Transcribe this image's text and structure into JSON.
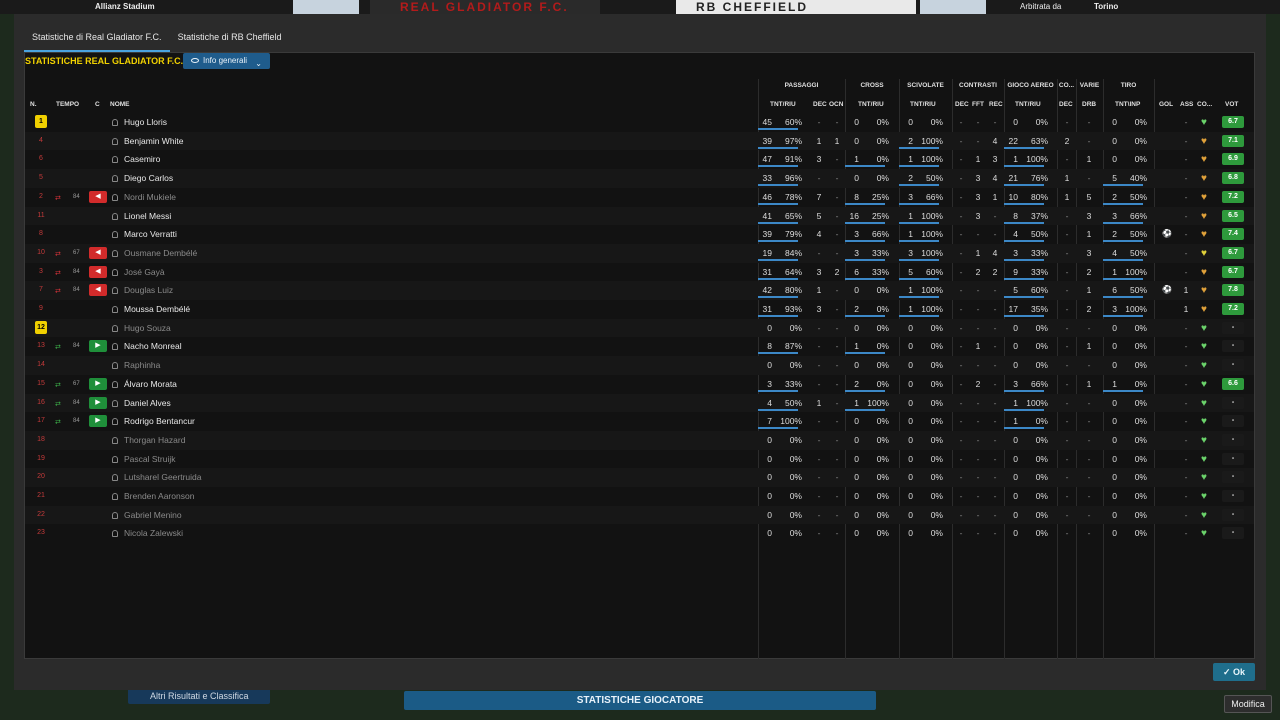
{
  "background": {
    "stadium": "Allianz Stadium",
    "referee": "Arbitrata da",
    "city": "Torino",
    "banner_left": "REAL GLADIATOR F.C.",
    "banner_right": "RB CHEFFIELD",
    "other_results": "Altri Risultati e Classifica",
    "player_stats": "STATISTICHE GIOCATORE",
    "edit": "Modifica"
  },
  "tabs": [
    "Statistiche di Real Gladiator F.C.",
    "Statistiche di RB Cheffield"
  ],
  "panel": {
    "title": "STATISTICHE REAL GLADIATOR F.C.",
    "view_button": "Info generali"
  },
  "ok_button": "Ok",
  "groups": [
    "PASSAGGI",
    "CROSS",
    "SCIVOLATE",
    "CONTRASTI",
    "GIOCO AEREO",
    "CO...",
    "VARIE",
    "TIRO"
  ],
  "headers": {
    "n": "N.",
    "tempo": "TEMPO",
    "c": "C",
    "nome": "NOME",
    "pass": "TNT/RIU",
    "dec": "DEC",
    "ocn": "OCN",
    "cross": "TNT/RIU",
    "scivolate": "TNT/RIU",
    "cdec": "DEC",
    "fft": "FFT",
    "rec": "REC",
    "aereo": "TNT/RIU",
    "codec": "DEC",
    "drb": "DRB",
    "tiro": "TNT\\INP",
    "gol": "GOL",
    "ass": "ASS",
    "co": "CO...",
    "vot": "VOT"
  },
  "players": [
    {
      "n": "1",
      "gk": true,
      "name": "Hugo Lloris",
      "dim": false,
      "sub": null,
      "p": [
        "45",
        "60%"
      ],
      "pd": "-",
      "po": "-",
      "c": [
        "0",
        "0%"
      ],
      "s": [
        "0",
        "0%"
      ],
      "cd": "-",
      "cf": "-",
      "cr": "-",
      "a": [
        "0",
        "0%"
      ],
      "ad": "-",
      "drb": "-",
      "t": [
        "0",
        "0%"
      ],
      "gol": "",
      "ass": "-",
      "vote": "6.7",
      "hc": "#6bd36b"
    },
    {
      "n": "4",
      "name": "Benjamin White",
      "dim": false,
      "sub": null,
      "p": [
        "39",
        "97%"
      ],
      "pd": "1",
      "po": "1",
      "c": [
        "0",
        "0%"
      ],
      "s": [
        "2",
        "100%"
      ],
      "cd": "-",
      "cf": "-",
      "cr": "4",
      "a": [
        "22",
        "63%"
      ],
      "ad": "2",
      "drb": "-",
      "t": [
        "0",
        "0%"
      ],
      "gol": "",
      "ass": "-",
      "vote": "7.1",
      "hc": "#e0a13a"
    },
    {
      "n": "6",
      "name": "Casemiro",
      "dim": false,
      "sub": null,
      "p": [
        "47",
        "91%"
      ],
      "pd": "3",
      "po": "-",
      "c": [
        "1",
        "0%"
      ],
      "s": [
        "1",
        "100%"
      ],
      "cd": "-",
      "cf": "1",
      "cr": "3",
      "a": [
        "1",
        "100%"
      ],
      "ad": "-",
      "drb": "1",
      "t": [
        "0",
        "0%"
      ],
      "gol": "",
      "ass": "-",
      "vote": "6.9",
      "hc": "#e0a13a"
    },
    {
      "n": "5",
      "name": "Diego Carlos",
      "dim": false,
      "sub": null,
      "p": [
        "33",
        "96%"
      ],
      "pd": "-",
      "po": "-",
      "c": [
        "0",
        "0%"
      ],
      "s": [
        "2",
        "50%"
      ],
      "cd": "-",
      "cf": "3",
      "cr": "4",
      "a": [
        "21",
        "76%"
      ],
      "ad": "1",
      "drb": "-",
      "t": [
        "5",
        "40%"
      ],
      "gol": "",
      "ass": "-",
      "vote": "6.8",
      "hc": "#e0a13a"
    },
    {
      "n": "2",
      "name": "Nordi Mukiele",
      "dim": true,
      "sub": {
        "type": "off",
        "min": "84"
      },
      "p": [
        "46",
        "78%"
      ],
      "pd": "7",
      "po": "-",
      "c": [
        "8",
        "25%"
      ],
      "s": [
        "3",
        "66%"
      ],
      "cd": "-",
      "cf": "3",
      "cr": "1",
      "a": [
        "10",
        "80%"
      ],
      "ad": "1",
      "drb": "5",
      "t": [
        "2",
        "50%"
      ],
      "gol": "",
      "ass": "-",
      "vote": "7.2",
      "hc": "#e0a13a"
    },
    {
      "n": "11",
      "name": "Lionel Messi",
      "dim": false,
      "sub": null,
      "p": [
        "41",
        "65%"
      ],
      "pd": "5",
      "po": "-",
      "c": [
        "16",
        "25%"
      ],
      "s": [
        "1",
        "100%"
      ],
      "cd": "-",
      "cf": "3",
      "cr": "-",
      "a": [
        "8",
        "37%"
      ],
      "ad": "-",
      "drb": "3",
      "t": [
        "3",
        "66%"
      ],
      "gol": "",
      "ass": "-",
      "vote": "6.5",
      "hc": "#e0a13a"
    },
    {
      "n": "8",
      "name": "Marco Verratti",
      "dim": false,
      "sub": null,
      "p": [
        "39",
        "79%"
      ],
      "pd": "4",
      "po": "-",
      "c": [
        "3",
        "66%"
      ],
      "s": [
        "1",
        "100%"
      ],
      "cd": "-",
      "cf": "-",
      "cr": "-",
      "a": [
        "4",
        "50%"
      ],
      "ad": "-",
      "drb": "1",
      "t": [
        "2",
        "50%"
      ],
      "gol": "ball",
      "ass": "-",
      "vote": "7.4",
      "hc": "#e0a13a"
    },
    {
      "n": "10",
      "name": "Ousmane Dembélé",
      "dim": true,
      "sub": {
        "type": "off",
        "min": "67"
      },
      "p": [
        "19",
        "84%"
      ],
      "pd": "-",
      "po": "-",
      "c": [
        "3",
        "33%"
      ],
      "s": [
        "3",
        "100%"
      ],
      "cd": "-",
      "cf": "1",
      "cr": "4",
      "a": [
        "3",
        "33%"
      ],
      "ad": "-",
      "drb": "3",
      "t": [
        "4",
        "50%"
      ],
      "gol": "",
      "ass": "-",
      "vote": "6.7",
      "hc": "#e0d03a"
    },
    {
      "n": "3",
      "name": "José Gayà",
      "dim": true,
      "sub": {
        "type": "off",
        "min": "84"
      },
      "p": [
        "31",
        "64%"
      ],
      "pd": "3",
      "po": "2",
      "c": [
        "6",
        "33%"
      ],
      "s": [
        "5",
        "60%"
      ],
      "cd": "-",
      "cf": "2",
      "cr": "2",
      "a": [
        "9",
        "33%"
      ],
      "ad": "-",
      "drb": "2",
      "t": [
        "1",
        "100%"
      ],
      "gol": "",
      "ass": "-",
      "vote": "6.7",
      "hc": "#e0a13a"
    },
    {
      "n": "7",
      "name": "Douglas Luiz",
      "dim": true,
      "sub": {
        "type": "off",
        "min": "84"
      },
      "p": [
        "42",
        "80%"
      ],
      "pd": "1",
      "po": "-",
      "c": [
        "0",
        "0%"
      ],
      "s": [
        "1",
        "100%"
      ],
      "cd": "-",
      "cf": "-",
      "cr": "-",
      "a": [
        "5",
        "60%"
      ],
      "ad": "-",
      "drb": "1",
      "t": [
        "6",
        "50%"
      ],
      "gol": "ball",
      "ass": "1",
      "vote": "7.8",
      "hc": "#e0a13a"
    },
    {
      "n": "9",
      "name": "Moussa Dembélé",
      "dim": false,
      "sub": null,
      "p": [
        "31",
        "93%"
      ],
      "pd": "3",
      "po": "-",
      "c": [
        "2",
        "0%"
      ],
      "s": [
        "1",
        "100%"
      ],
      "cd": "-",
      "cf": "-",
      "cr": "-",
      "a": [
        "17",
        "35%"
      ],
      "ad": "-",
      "drb": "2",
      "t": [
        "3",
        "100%"
      ],
      "gol": "",
      "ass": "1",
      "vote": "7.2",
      "hc": "#e0a13a"
    },
    {
      "n": "12",
      "gk": true,
      "name": "Hugo Souza",
      "dim": true,
      "sub": null,
      "p": [
        "0",
        "0%"
      ],
      "pd": "-",
      "po": "-",
      "c": [
        "0",
        "0%"
      ],
      "s": [
        "0",
        "0%"
      ],
      "cd": "-",
      "cf": "-",
      "cr": "-",
      "a": [
        "0",
        "0%"
      ],
      "ad": "-",
      "drb": "-",
      "t": [
        "0",
        "0%"
      ],
      "gol": "",
      "ass": "-",
      "vote": "-",
      "hc": "#6bd36b"
    },
    {
      "n": "13",
      "name": "Nacho Monreal",
      "dim": false,
      "sub": {
        "type": "on",
        "min": "84"
      },
      "p": [
        "8",
        "87%"
      ],
      "pd": "-",
      "po": "-",
      "c": [
        "1",
        "0%"
      ],
      "s": [
        "0",
        "0%"
      ],
      "cd": "-",
      "cf": "1",
      "cr": "-",
      "a": [
        "0",
        "0%"
      ],
      "ad": "-",
      "drb": "1",
      "t": [
        "0",
        "0%"
      ],
      "gol": "",
      "ass": "-",
      "vote": "-",
      "hc": "#6bd36b"
    },
    {
      "n": "14",
      "name": "Raphinha",
      "dim": true,
      "sub": null,
      "p": [
        "0",
        "0%"
      ],
      "pd": "-",
      "po": "-",
      "c": [
        "0",
        "0%"
      ],
      "s": [
        "0",
        "0%"
      ],
      "cd": "-",
      "cf": "-",
      "cr": "-",
      "a": [
        "0",
        "0%"
      ],
      "ad": "-",
      "drb": "-",
      "t": [
        "0",
        "0%"
      ],
      "gol": "",
      "ass": "-",
      "vote": "-",
      "hc": "#6bd36b"
    },
    {
      "n": "15",
      "name": "Álvaro Morata",
      "dim": false,
      "sub": {
        "type": "on",
        "min": "67"
      },
      "p": [
        "3",
        "33%"
      ],
      "pd": "-",
      "po": "-",
      "c": [
        "2",
        "0%"
      ],
      "s": [
        "0",
        "0%"
      ],
      "cd": "-",
      "cf": "2",
      "cr": "-",
      "a": [
        "3",
        "66%"
      ],
      "ad": "-",
      "drb": "1",
      "t": [
        "1",
        "0%"
      ],
      "gol": "",
      "ass": "-",
      "vote": "6.6",
      "hc": "#6bd36b"
    },
    {
      "n": "16",
      "name": "Daniel Alves",
      "dim": false,
      "sub": {
        "type": "on",
        "min": "84"
      },
      "p": [
        "4",
        "50%"
      ],
      "pd": "1",
      "po": "-",
      "c": [
        "1",
        "100%"
      ],
      "s": [
        "0",
        "0%"
      ],
      "cd": "-",
      "cf": "-",
      "cr": "-",
      "a": [
        "1",
        "100%"
      ],
      "ad": "-",
      "drb": "-",
      "t": [
        "0",
        "0%"
      ],
      "gol": "",
      "ass": "-",
      "vote": "-",
      "hc": "#6bd36b"
    },
    {
      "n": "17",
      "name": "Rodrigo Bentancur",
      "dim": false,
      "sub": {
        "type": "on",
        "min": "84"
      },
      "p": [
        "7",
        "100%"
      ],
      "pd": "-",
      "po": "-",
      "c": [
        "0",
        "0%"
      ],
      "s": [
        "0",
        "0%"
      ],
      "cd": "-",
      "cf": "-",
      "cr": "-",
      "a": [
        "1",
        "0%"
      ],
      "ad": "-",
      "drb": "-",
      "t": [
        "0",
        "0%"
      ],
      "gol": "",
      "ass": "-",
      "vote": "-",
      "hc": "#6bd36b"
    },
    {
      "n": "18",
      "name": "Thorgan Hazard",
      "dim": true,
      "sub": null,
      "p": [
        "0",
        "0%"
      ],
      "pd": "-",
      "po": "-",
      "c": [
        "0",
        "0%"
      ],
      "s": [
        "0",
        "0%"
      ],
      "cd": "-",
      "cf": "-",
      "cr": "-",
      "a": [
        "0",
        "0%"
      ],
      "ad": "-",
      "drb": "-",
      "t": [
        "0",
        "0%"
      ],
      "gol": "",
      "ass": "-",
      "vote": "-",
      "hc": "#6bd36b"
    },
    {
      "n": "19",
      "name": "Pascal Struijk",
      "dim": true,
      "sub": null,
      "p": [
        "0",
        "0%"
      ],
      "pd": "-",
      "po": "-",
      "c": [
        "0",
        "0%"
      ],
      "s": [
        "0",
        "0%"
      ],
      "cd": "-",
      "cf": "-",
      "cr": "-",
      "a": [
        "0",
        "0%"
      ],
      "ad": "-",
      "drb": "-",
      "t": [
        "0",
        "0%"
      ],
      "gol": "",
      "ass": "-",
      "vote": "-",
      "hc": "#6bd36b"
    },
    {
      "n": "20",
      "name": "Lutsharel Geertruida",
      "dim": true,
      "sub": null,
      "p": [
        "0",
        "0%"
      ],
      "pd": "-",
      "po": "-",
      "c": [
        "0",
        "0%"
      ],
      "s": [
        "0",
        "0%"
      ],
      "cd": "-",
      "cf": "-",
      "cr": "-",
      "a": [
        "0",
        "0%"
      ],
      "ad": "-",
      "drb": "-",
      "t": [
        "0",
        "0%"
      ],
      "gol": "",
      "ass": "-",
      "vote": "-",
      "hc": "#6bd36b"
    },
    {
      "n": "21",
      "name": "Brenden Aaronson",
      "dim": true,
      "sub": null,
      "p": [
        "0",
        "0%"
      ],
      "pd": "-",
      "po": "-",
      "c": [
        "0",
        "0%"
      ],
      "s": [
        "0",
        "0%"
      ],
      "cd": "-",
      "cf": "-",
      "cr": "-",
      "a": [
        "0",
        "0%"
      ],
      "ad": "-",
      "drb": "-",
      "t": [
        "0",
        "0%"
      ],
      "gol": "",
      "ass": "-",
      "vote": "-",
      "hc": "#6bd36b"
    },
    {
      "n": "22",
      "name": "Gabriel Menino",
      "dim": true,
      "sub": null,
      "p": [
        "0",
        "0%"
      ],
      "pd": "-",
      "po": "-",
      "c": [
        "0",
        "0%"
      ],
      "s": [
        "0",
        "0%"
      ],
      "cd": "-",
      "cf": "-",
      "cr": "-",
      "a": [
        "0",
        "0%"
      ],
      "ad": "-",
      "drb": "-",
      "t": [
        "0",
        "0%"
      ],
      "gol": "",
      "ass": "-",
      "vote": "-",
      "hc": "#6bd36b"
    },
    {
      "n": "23",
      "name": "Nicola Zalewski",
      "dim": true,
      "sub": null,
      "p": [
        "0",
        "0%"
      ],
      "pd": "-",
      "po": "-",
      "c": [
        "0",
        "0%"
      ],
      "s": [
        "0",
        "0%"
      ],
      "cd": "-",
      "cf": "-",
      "cr": "-",
      "a": [
        "0",
        "0%"
      ],
      "ad": "-",
      "drb": "-",
      "t": [
        "0",
        "0%"
      ],
      "gol": "",
      "ass": "-",
      "vote": "-",
      "hc": "#6bd36b"
    }
  ]
}
